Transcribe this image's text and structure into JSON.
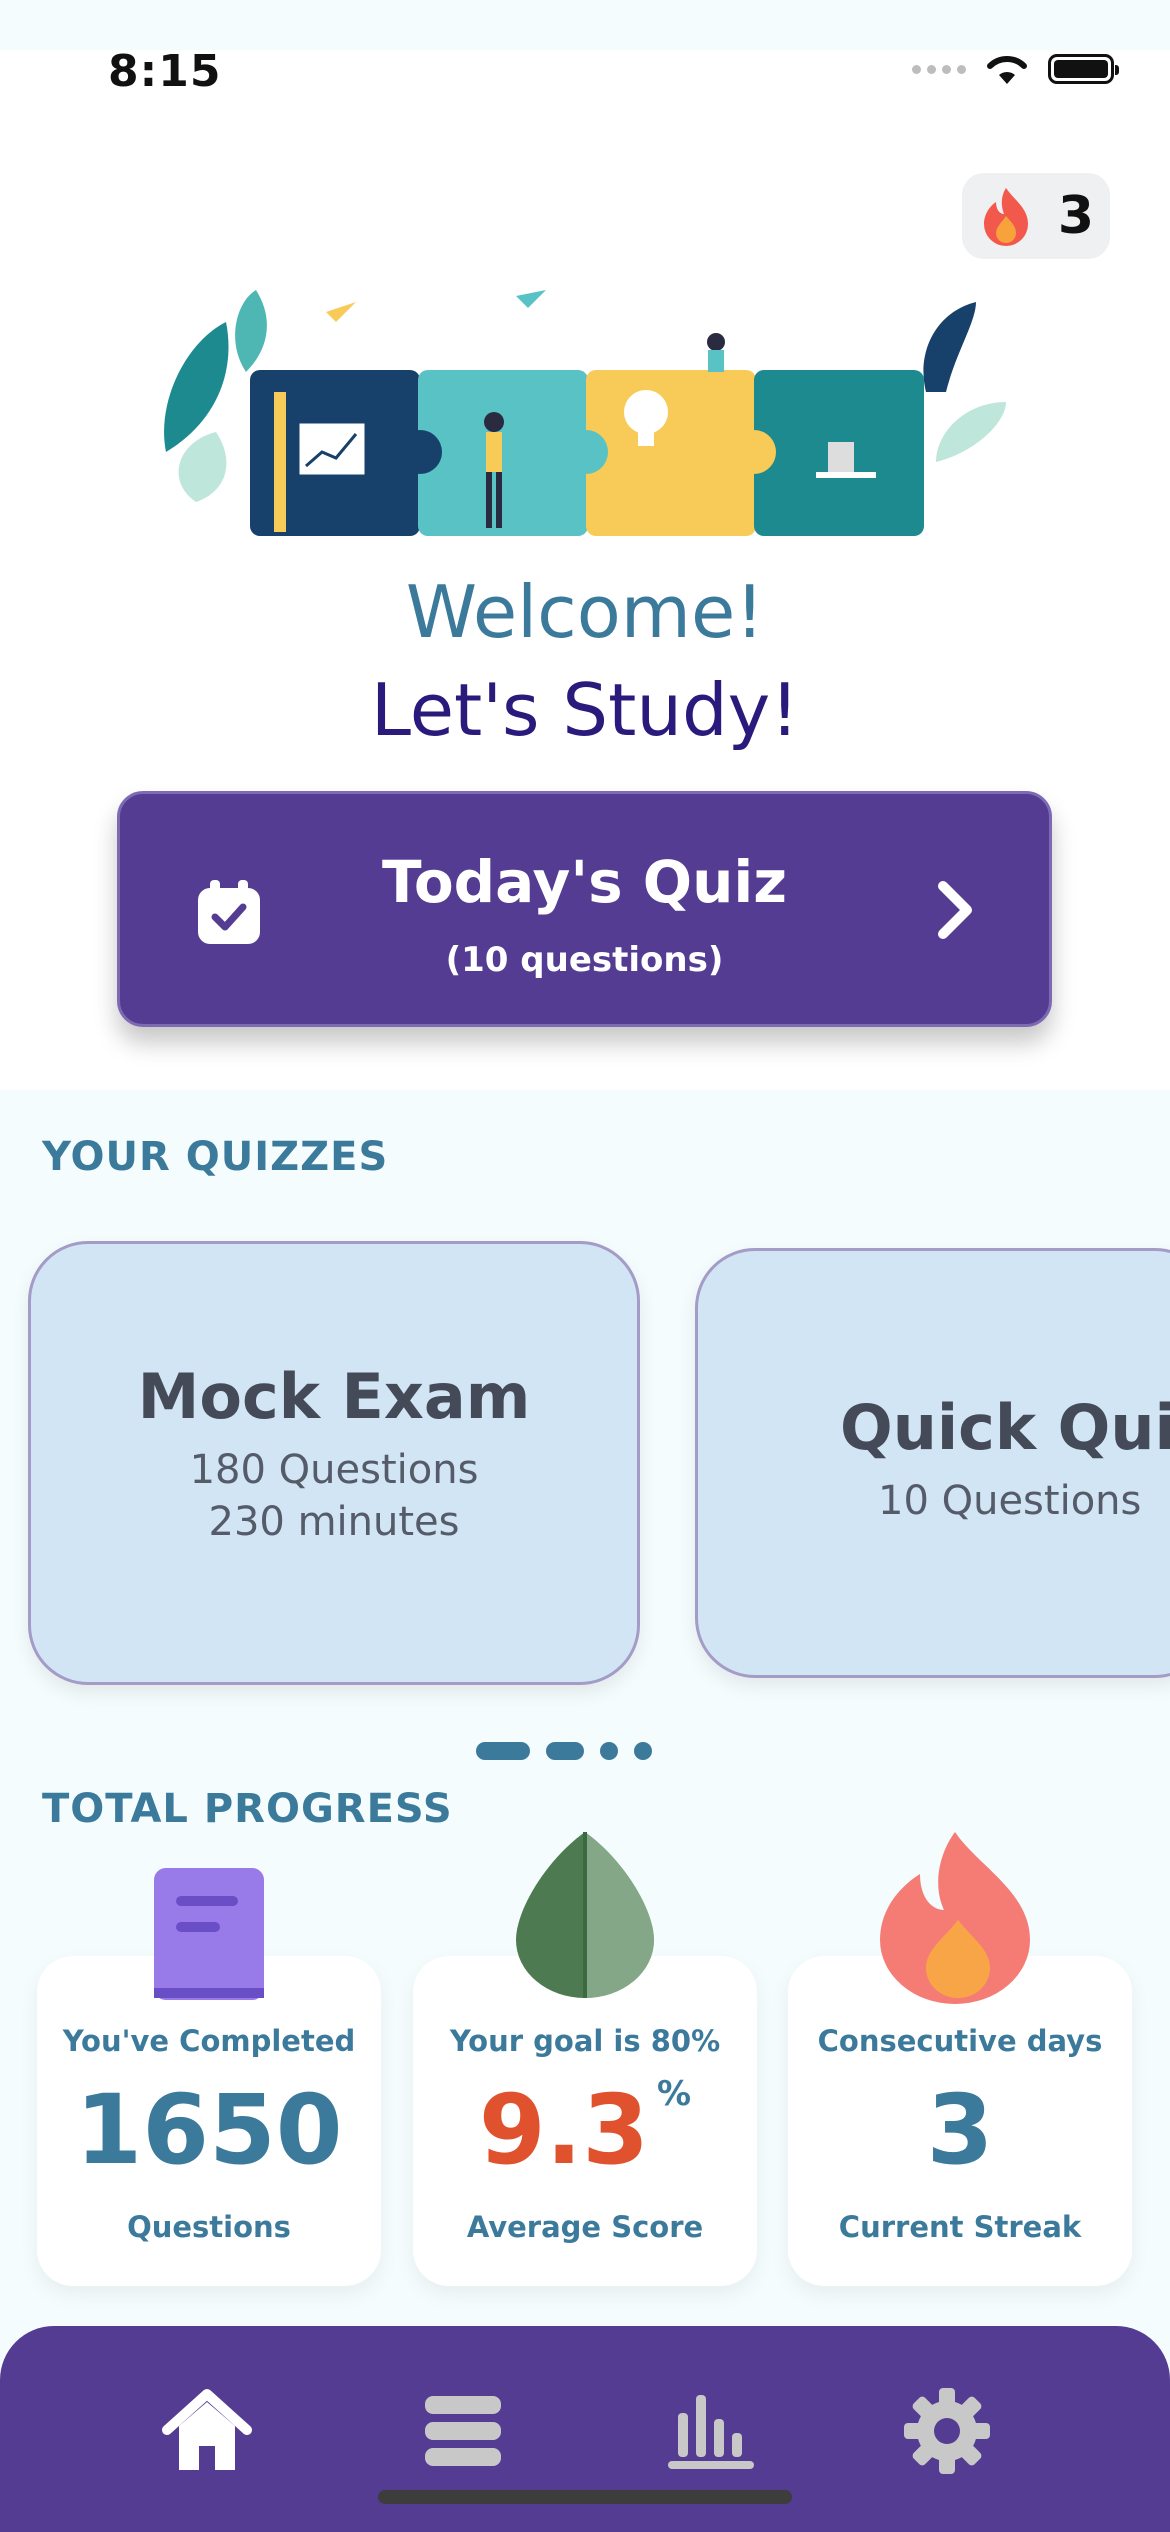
{
  "status_bar": {
    "time": "8:15"
  },
  "streak_badge": {
    "count": "3",
    "icon": "fire-icon"
  },
  "hero": {
    "welcome": "Welcome!",
    "subtitle": "Let's Study!"
  },
  "daily_quiz": {
    "title": "Today's Quiz",
    "subtitle": "(10 questions)",
    "icon": "calendar-check-icon"
  },
  "quizzes": {
    "section_label": "YOUR QUIZZES",
    "cards": [
      {
        "title": "Mock Exam",
        "line1": "180 Questions",
        "line2": "230 minutes"
      },
      {
        "title": "Quick Quiz",
        "line1": "10 Questions"
      }
    ],
    "page_count": 4,
    "active_page": 0
  },
  "progress": {
    "section_label": "TOTAL PROGRESS",
    "completed": {
      "top": "You've Completed",
      "value": "1650",
      "bottom": "Questions",
      "icon": "book-icon"
    },
    "score": {
      "top": "Your goal is 80%",
      "value": "9.3",
      "unit": "%",
      "bottom": "Average Score",
      "icon": "leaf-icon"
    },
    "streak": {
      "top": "Consecutive days",
      "value": "3",
      "bottom": "Current Streak",
      "icon": "flame-icon"
    }
  },
  "nav": [
    {
      "name": "home",
      "icon": "home-icon",
      "active": true
    },
    {
      "name": "quizzes",
      "icon": "list-icon",
      "active": false
    },
    {
      "name": "stats",
      "icon": "bar-chart-icon",
      "active": false
    },
    {
      "name": "settings",
      "icon": "gear-icon",
      "active": false
    }
  ],
  "colors": {
    "primary": "#543c93",
    "accent": "#3c7a9c",
    "score_red": "#e0522d",
    "card_bg": "#d1e5f4"
  }
}
